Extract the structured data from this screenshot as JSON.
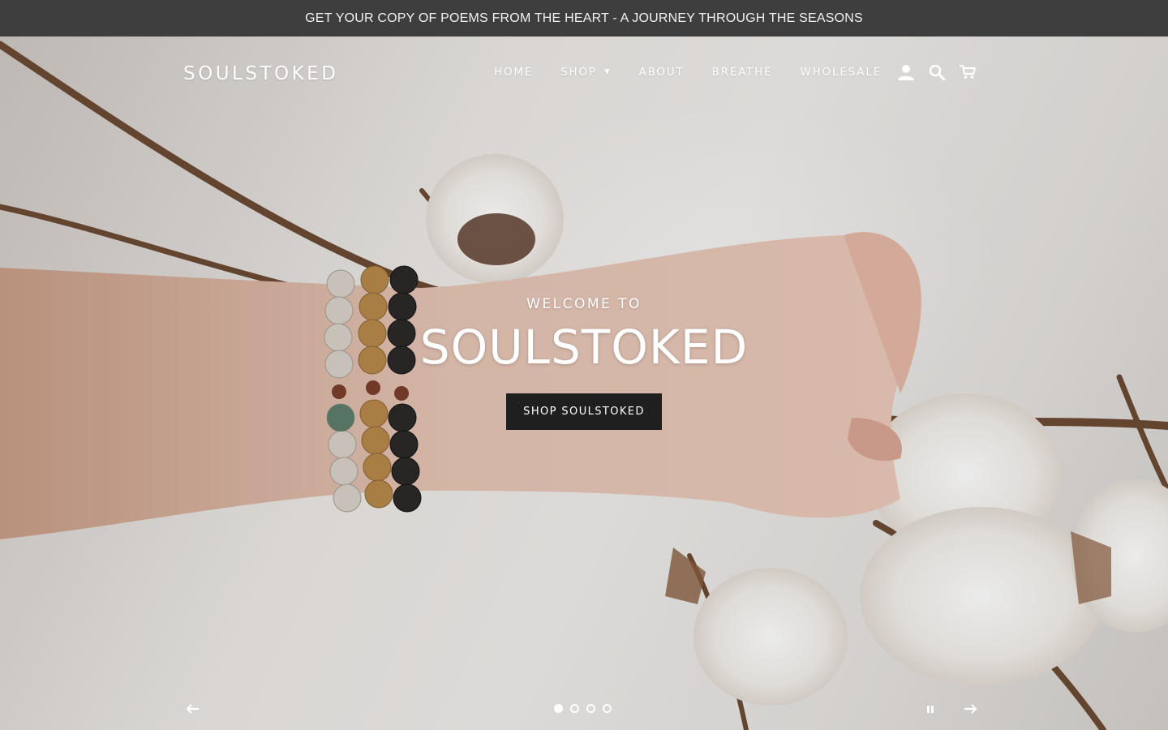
{
  "announcement": {
    "text": "GET YOUR COPY OF POEMS FROM THE HEART - A JOURNEY THROUGH THE SEASONS"
  },
  "header": {
    "logo": "SOULSTOKED",
    "nav": [
      {
        "label": "HOME"
      },
      {
        "label": "SHOP",
        "has_dropdown": true
      },
      {
        "label": "ABOUT"
      },
      {
        "label": "BREATHE"
      },
      {
        "label": "WHOLESALE"
      }
    ],
    "icons": [
      "user-icon",
      "search-icon",
      "cart-icon"
    ]
  },
  "hero": {
    "kicker": "WELCOME TO",
    "title": "SOULSTOKED",
    "cta": "SHOP SOULSTOKED",
    "slides_count": 4,
    "active_slide": 1
  },
  "colors": {
    "announcement_bg": "#3d3e3d",
    "button_bg": "#1f1f1f",
    "text_light": "#ffffff"
  }
}
